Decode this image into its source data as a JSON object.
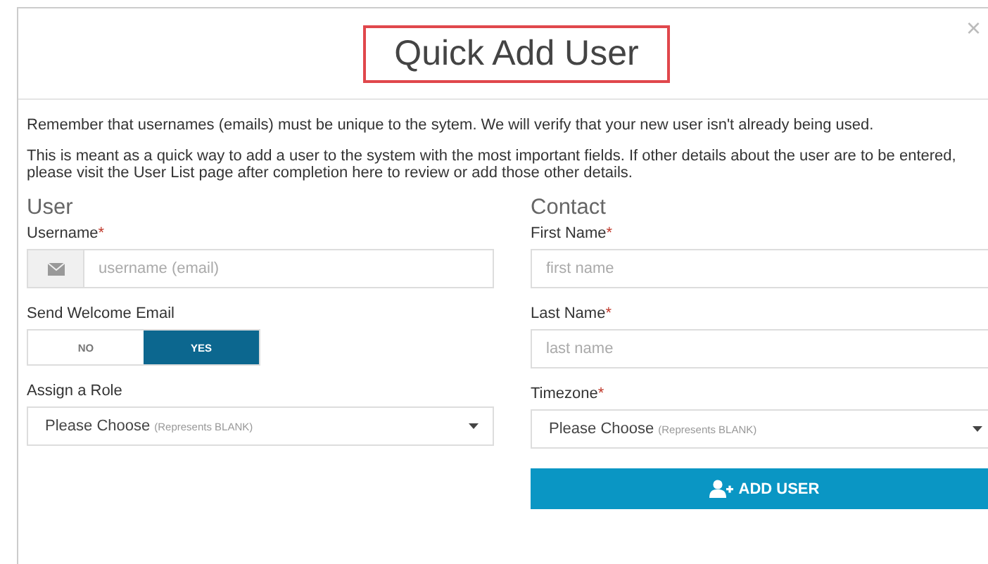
{
  "dialog": {
    "title": "Quick Add User",
    "close": "×",
    "paragraphs": [
      "Remember that usernames (emails) must be unique to the sytem. We will verify that your new user isn't already being used.",
      "This is meant as a quick way to add a user to the system with the most important fields. If other details about the user are to be entered, please visit the User List page after completion here to review or add those other details."
    ],
    "columns": [
      {
        "heading": "User",
        "fields": [
          {
            "kind": "icon-input",
            "label": "Username",
            "required_mark": "*",
            "placeholder": "username (email)"
          },
          {
            "kind": "toggle",
            "label": "Send Welcome Email",
            "options": [
              {
                "label": "NO",
                "selected": false
              },
              {
                "label": "YES",
                "selected": true
              }
            ]
          },
          {
            "kind": "select",
            "label": "Assign a Role",
            "value": "Please Choose",
            "hint": "(Represents BLANK)"
          }
        ]
      },
      {
        "heading": "Contact",
        "fields": [
          {
            "kind": "input",
            "label": "First Name",
            "required_mark": "*",
            "placeholder": "first name"
          },
          {
            "kind": "input",
            "label": "Last Name",
            "required_mark": "*",
            "placeholder": "last name"
          },
          {
            "kind": "select",
            "label": "Timezone",
            "required_mark": "*",
            "value": "Please Choose",
            "hint": "(Represents BLANK)"
          },
          {
            "kind": "button",
            "label": "ADD USER"
          }
        ]
      }
    ]
  }
}
